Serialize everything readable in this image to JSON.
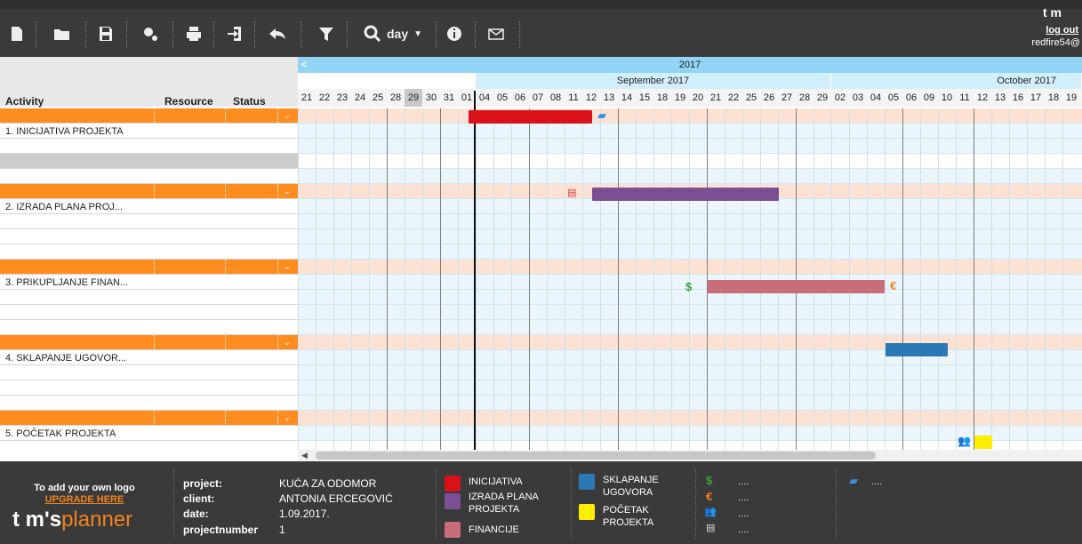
{
  "toolbar": {
    "buttons": [
      "new-file",
      "open-folder",
      "save",
      "settings",
      "print",
      "export",
      "undo",
      "filter",
      "zoom",
      "info",
      "email"
    ],
    "zoom_label": "day",
    "logout": "log out",
    "user": "redfire54@",
    "corner_logo": "t m"
  },
  "columns": {
    "activity": "Activity",
    "resource": "Resource",
    "status": "Status"
  },
  "timeline": {
    "year": "2017",
    "months": [
      "September 2017",
      "October 2017"
    ],
    "days": [
      "21",
      "22",
      "23",
      "24",
      "25",
      "28",
      "29",
      "30",
      "31",
      "01",
      "04",
      "05",
      "06",
      "07",
      "08",
      "11",
      "12",
      "13",
      "14",
      "15",
      "18",
      "19",
      "20",
      "21",
      "22",
      "25",
      "26",
      "27",
      "28",
      "29",
      "02",
      "03",
      "04",
      "05",
      "06",
      "09",
      "10",
      "11",
      "12",
      "13",
      "16",
      "17",
      "18",
      "19"
    ],
    "today_day": "29"
  },
  "activities": [
    {
      "label": "1. INICIJATIVA PROJEKTA"
    },
    {
      "label": "2. IZRADA PLANA PROJ..."
    },
    {
      "label": "3. PRIKUPLJANJE FINAN..."
    },
    {
      "label": "4. SKLAPANJE UGOVOR..."
    },
    {
      "label": "5. POČETAK PROJEKTA"
    }
  ],
  "colors": {
    "inicijativa": "#d9121a",
    "izrada": "#7b4f94",
    "financije": "#c86e78",
    "sklapanje": "#2c78b5",
    "pocetak": "#ffee00",
    "orange": "#ff8c1e"
  },
  "footer": {
    "promo": "To add your own logo",
    "upgrade": "UPGRADE HERE",
    "brand_tom": "t m's",
    "brand_planner": "planner",
    "project_label": "project:",
    "project_value": "KUĆA ZA ODOMOR",
    "client_label": "client:",
    "client_value": "ANTONIA ERCEGOVIĆ",
    "date_label": "date:",
    "date_value": "1.09.2017.",
    "number_label": "projectnumber",
    "number_value": "1",
    "legend": {
      "inicijativa": "INICIJATIVA",
      "izrada": "IZRADA PLANA PROJEKTA",
      "financije": "FINANCIJE",
      "sklapanje": "SKLAPANJE UGOVORA",
      "pocetak": "POČETAK PROJEKTA"
    },
    "icon_dots": "...."
  }
}
